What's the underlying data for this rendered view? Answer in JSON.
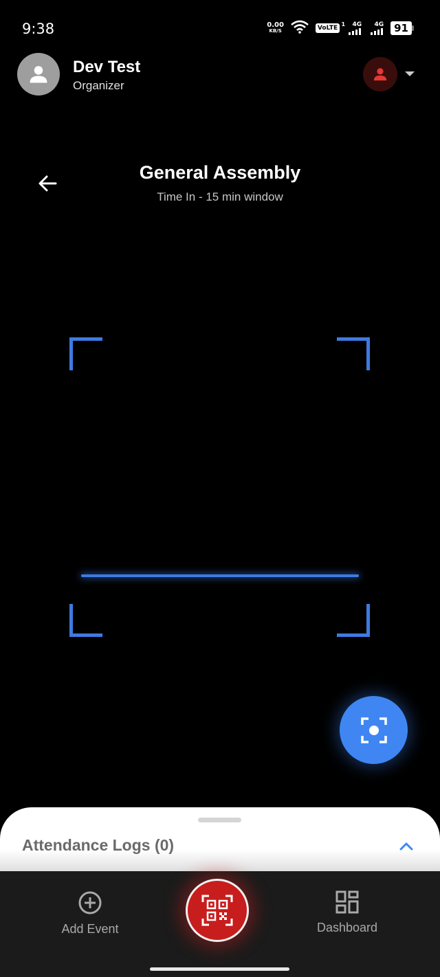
{
  "status_bar": {
    "time": "9:38",
    "net_speed_value": "0.00",
    "net_speed_unit": "KB/S",
    "volte": "VoLTE",
    "volte_sup": "1",
    "sim1": "4G",
    "sim2": "4G",
    "battery": "91"
  },
  "header": {
    "user_name": "Dev Test",
    "user_role": "Organizer"
  },
  "event": {
    "title": "General Assembly",
    "subtitle": "Time In - 15 min window"
  },
  "sheet": {
    "title": "Attendance Logs (0)"
  },
  "nav": {
    "add_event_label": "Add Event",
    "dashboard_label": "Dashboard"
  },
  "icons": {
    "back": "arrow-left-icon",
    "avatar": "person-icon",
    "account": "person-icon",
    "capture": "camera-focus-icon",
    "add_event": "plus-circle-icon",
    "scan": "qr-code-icon",
    "dashboard": "dashboard-grid-icon",
    "collapse": "chevron-up-icon"
  },
  "colors": {
    "accent_blue": "#3f86f2",
    "scanner_blue": "#3d7be0",
    "scan_red": "#c81d1d",
    "account_red": "#e53935"
  }
}
